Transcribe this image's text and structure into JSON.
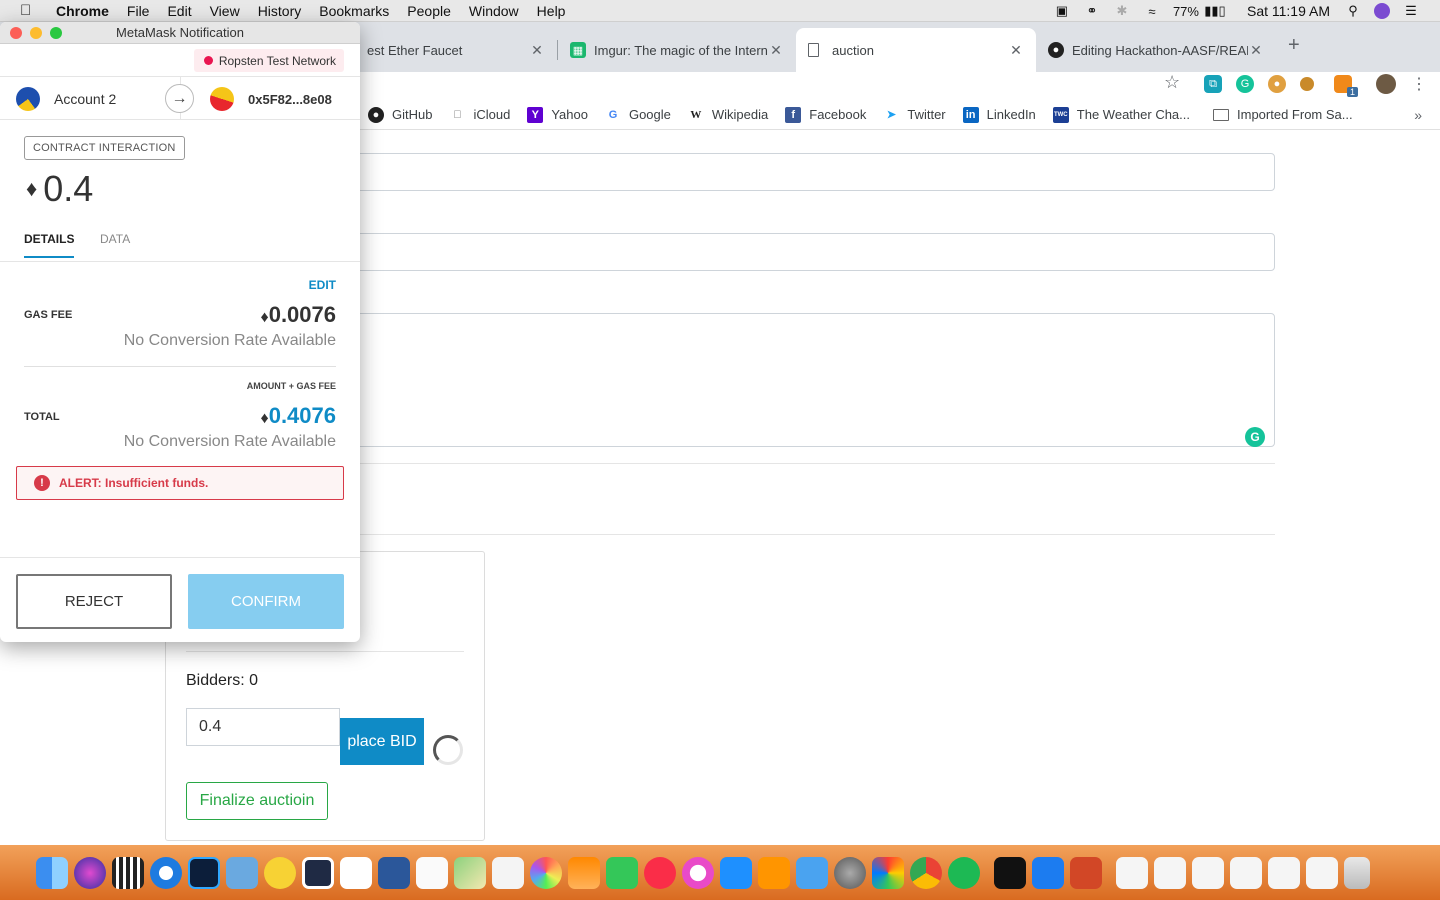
{
  "menubar": {
    "items": [
      "Chrome",
      "File",
      "Edit",
      "View",
      "History",
      "Bookmarks",
      "People",
      "Window",
      "Help"
    ],
    "battery": "77%",
    "clock": "Sat 11:19 AM"
  },
  "tabs": [
    {
      "label": "est Ether Faucet",
      "icon": "faucet-icon"
    },
    {
      "label": "Imgur: The magic of the Interne",
      "icon": "imgur-icon"
    },
    {
      "label": "auction",
      "icon": "page-icon"
    },
    {
      "label": "Editing Hackathon-AASF/README",
      "icon": "github-icon"
    }
  ],
  "bookmarks": [
    {
      "label": "GitHub",
      "icon": "github-icon"
    },
    {
      "label": "iCloud",
      "icon": "apple-icon"
    },
    {
      "label": "Yahoo",
      "icon": "yahoo-icon"
    },
    {
      "label": "Google",
      "icon": "google-icon"
    },
    {
      "label": "Wikipedia",
      "icon": "wikipedia-icon"
    },
    {
      "label": "Facebook",
      "icon": "facebook-icon"
    },
    {
      "label": "Twitter",
      "icon": "twitter-icon"
    },
    {
      "label": "LinkedIn",
      "icon": "linkedin-icon"
    },
    {
      "label": "The Weather Cha...",
      "icon": "weather-icon"
    },
    {
      "label": "Imported From Sa...",
      "icon": "folder-icon"
    }
  ],
  "extensions": {
    "metamask_badge": "1"
  },
  "page": {
    "bidders_label": "Bidders: 0",
    "bid_value": "0.4",
    "place_bid_label": "place BID",
    "finalize_label": "Finalize auctioin"
  },
  "metamask": {
    "window_title": "MetaMask Notification",
    "network": "Ropsten Test Network",
    "from_account": "Account 2",
    "to_address": "0x5F82...8e08",
    "contract_badge": "CONTRACT INTERACTION",
    "amount": "0.4",
    "tab_details": "DETAILS",
    "tab_data": "DATA",
    "edit_label": "EDIT",
    "gas_fee_label": "GAS FEE",
    "gas_fee_value": "0.0076",
    "no_conversion": "No Conversion Rate Available",
    "amount_plus_gas_label": "AMOUNT + GAS FEE",
    "total_label": "TOTAL",
    "total_value": "0.4076",
    "alert": "ALERT: Insufficient funds.",
    "reject_label": "REJECT",
    "confirm_label": "CONFIRM"
  },
  "colors": {
    "accent": "#0f8bc6",
    "confirm_disabled": "#86cdf0",
    "alert": "#d73a49",
    "network_dot": "#e91550",
    "finalize_green": "#28a745"
  }
}
